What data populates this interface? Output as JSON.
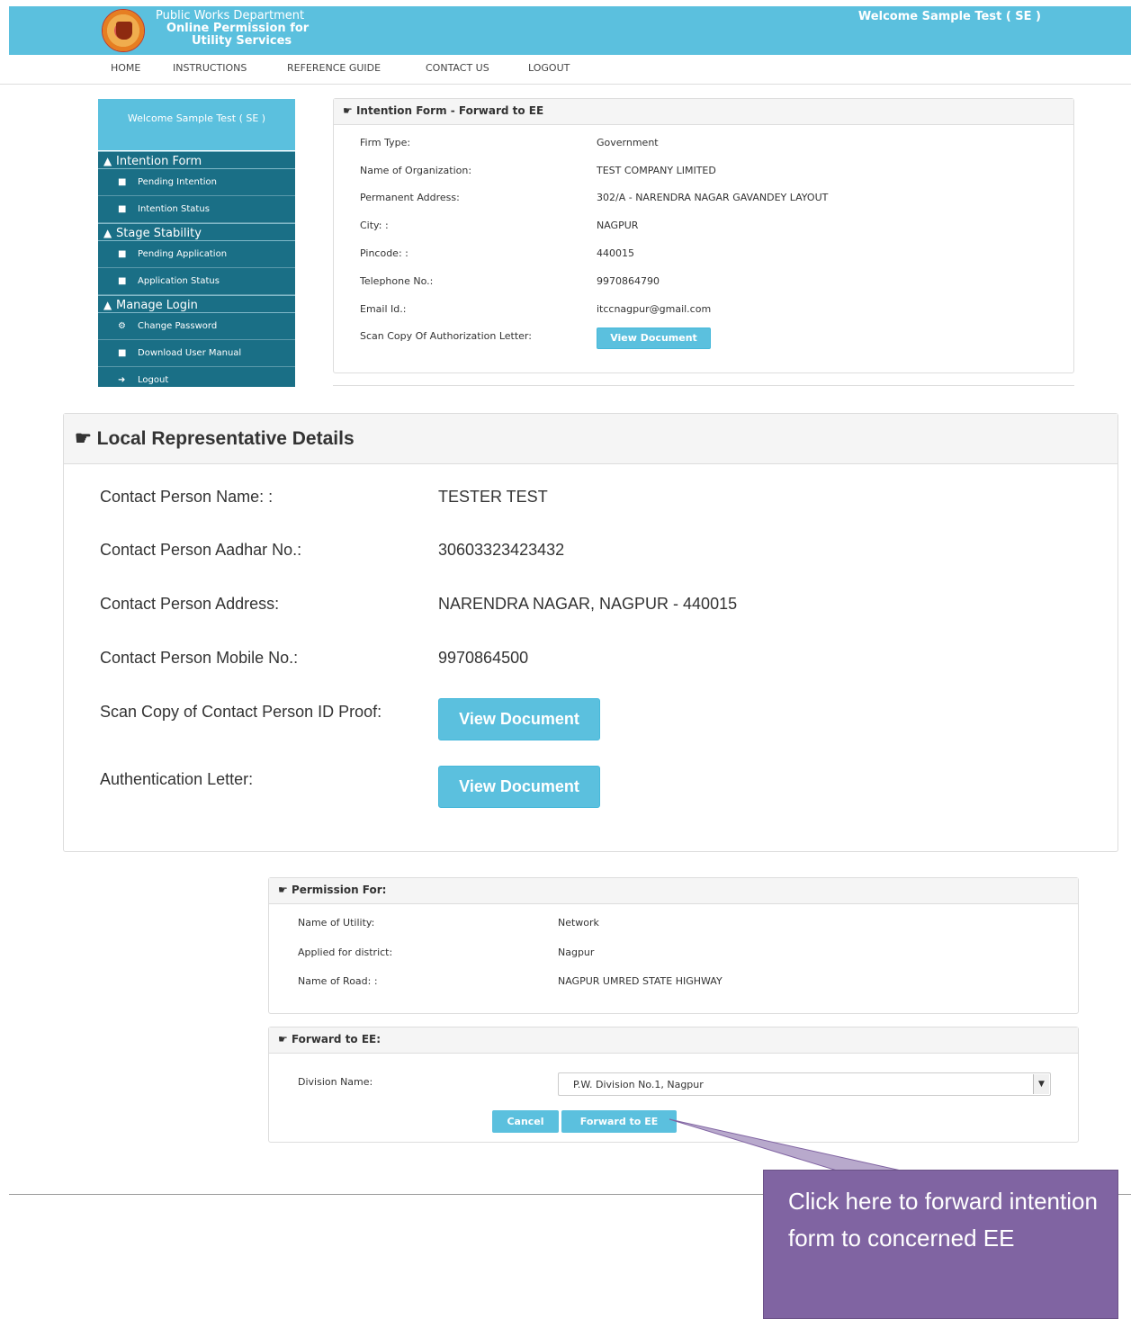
{
  "header": {
    "title_line1": "Public Works Department",
    "title_line2": "Online Permission for",
    "title_line3": "Utility Services",
    "welcome": "Welcome Sample Test ( SE )"
  },
  "nav": [
    "HOME",
    "INSTRUCTIONS",
    "REFERENCE GUIDE",
    "CONTACT US",
    "LOGOUT"
  ],
  "sidebar": {
    "welcome": "Welcome Sample Test ( SE )",
    "intention_form": "Intention Form",
    "pending_intention": "Pending Intention",
    "intention_status": "Intention Status",
    "stage_stability": "Stage Stability",
    "pending_application": "Pending Application",
    "application_status": "Application Status",
    "manage_login": "Manage Login",
    "change_password": "Change Password",
    "download_manual": "Download User Manual",
    "logout": "Logout"
  },
  "intention": {
    "title": "Intention Form - Forward to EE",
    "rows": [
      {
        "label": "Firm Type:",
        "value": "Government"
      },
      {
        "label": "Name of Organization:",
        "value": "TEST COMPANY LIMITED"
      },
      {
        "label": "Permanent Address:",
        "value": "302/A - NARENDRA NAGAR GAVANDEY LAYOUT"
      },
      {
        "label": "City: :",
        "value": "NAGPUR"
      },
      {
        "label": "Pincode: :",
        "value": "440015"
      },
      {
        "label": "Telephone No.:",
        "value": "9970864790"
      },
      {
        "label": "Email Id.:",
        "value": "itccnagpur@gmail.com"
      }
    ],
    "scan_label": "Scan Copy Of Authorization Letter:",
    "view_doc": "View Document"
  },
  "local_rep": {
    "title": "Local Representative Details",
    "rows": [
      {
        "label": "Contact Person Name: :",
        "value": "TESTER TEST"
      },
      {
        "label": "Contact Person Aadhar No.:",
        "value": "30603323423432"
      },
      {
        "label": "Contact Person Address:",
        "value": "NARENDRA NAGAR, NAGPUR - 440015"
      },
      {
        "label": "Contact Person Mobile No.:",
        "value": "9970864500"
      }
    ],
    "id_proof_label": "Scan Copy of Contact Person ID Proof:",
    "auth_letter_label": "Authentication Letter:",
    "view_doc": "View Document"
  },
  "permission": {
    "title": "Permission For:",
    "rows": [
      {
        "label": "Name of Utility:",
        "value": "Network"
      },
      {
        "label": "Applied for district:",
        "value": "Nagpur"
      },
      {
        "label": "Name of Road: :",
        "value": "NAGPUR UMRED STATE HIGHWAY"
      }
    ]
  },
  "forward": {
    "title": "Forward to EE:",
    "division_label": "Division Name:",
    "division_value": "P.W. Division No.1, Nagpur",
    "cancel": "Cancel",
    "forward_btn": "Forward to EE"
  },
  "callout": {
    "text": "Click here to forward intention form to concerned EE"
  }
}
